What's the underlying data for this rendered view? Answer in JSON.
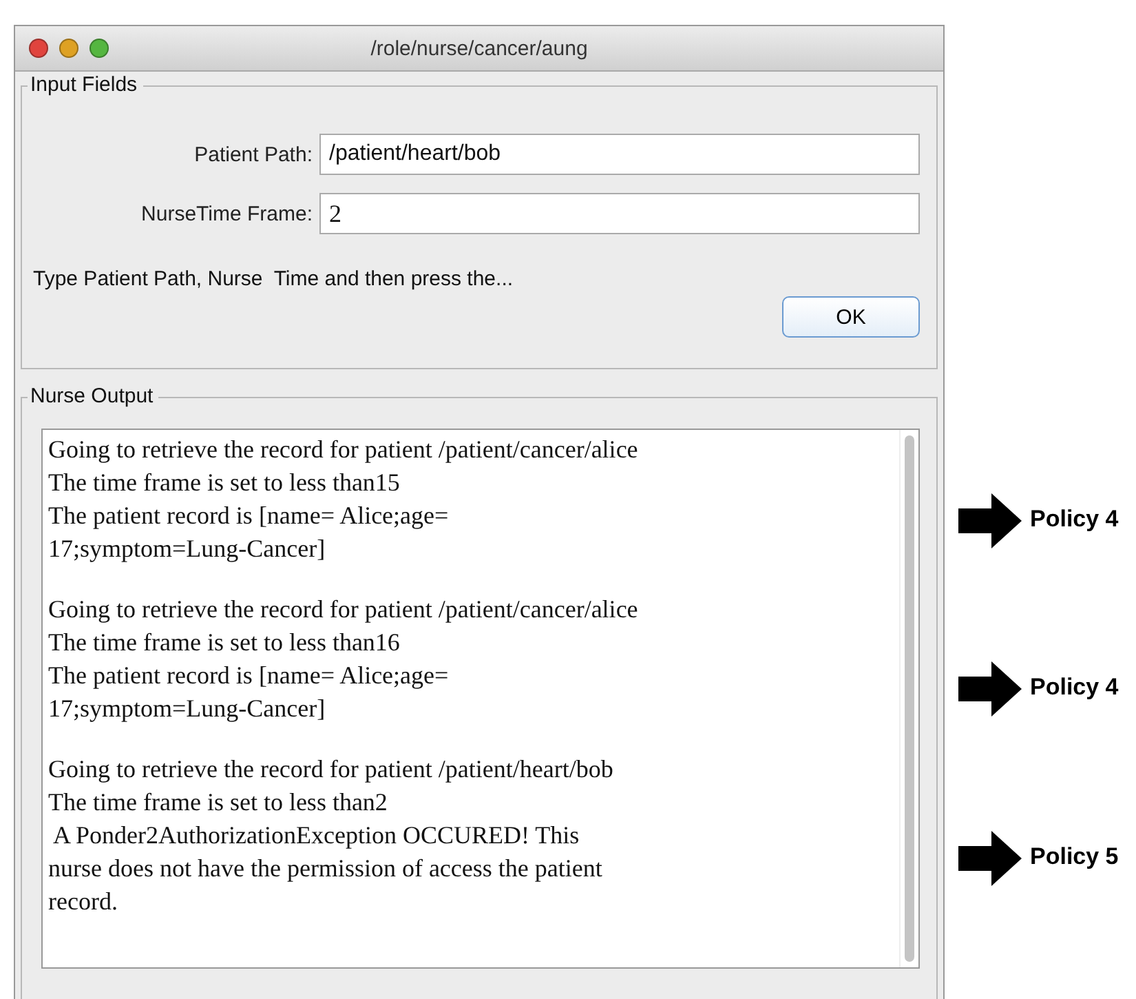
{
  "window": {
    "title": "/role/nurse/cancer/aung"
  },
  "input_fields": {
    "title": "Input Fields",
    "fields": [
      {
        "label": "Patient Path:",
        "value": "/patient/heart/bob",
        "serif": false
      },
      {
        "label": "NurseTime Frame:",
        "value": "2",
        "serif": true
      }
    ],
    "hint": "Type Patient Path, Nurse  Time and then press the...",
    "button": "OK"
  },
  "nurse_output": {
    "title": "Nurse Output",
    "blocks": [
      {
        "lines": [
          "Going to retrieve the record for patient /patient/cancer/alice",
          "The time frame is set to less than15",
          "The patient record is [name= Alice;age=",
          "17;symptom=Lung-Cancer]"
        ]
      },
      {
        "lines": [
          "Going to retrieve the record for patient /patient/cancer/alice",
          "The time frame is set to less than16",
          "The patient record is [name= Alice;age=",
          "17;symptom=Lung-Cancer]"
        ]
      },
      {
        "lines": [
          "Going to retrieve the record for patient /patient/heart/bob",
          "The time frame is set to less than2",
          " A Ponder2AuthorizationException OCCURED! This",
          "nurse does not have the permission of access the patient",
          "record."
        ]
      }
    ]
  },
  "annotations": [
    {
      "label": "Policy 4"
    },
    {
      "label": "Policy 4"
    },
    {
      "label": "Policy 5"
    }
  ]
}
